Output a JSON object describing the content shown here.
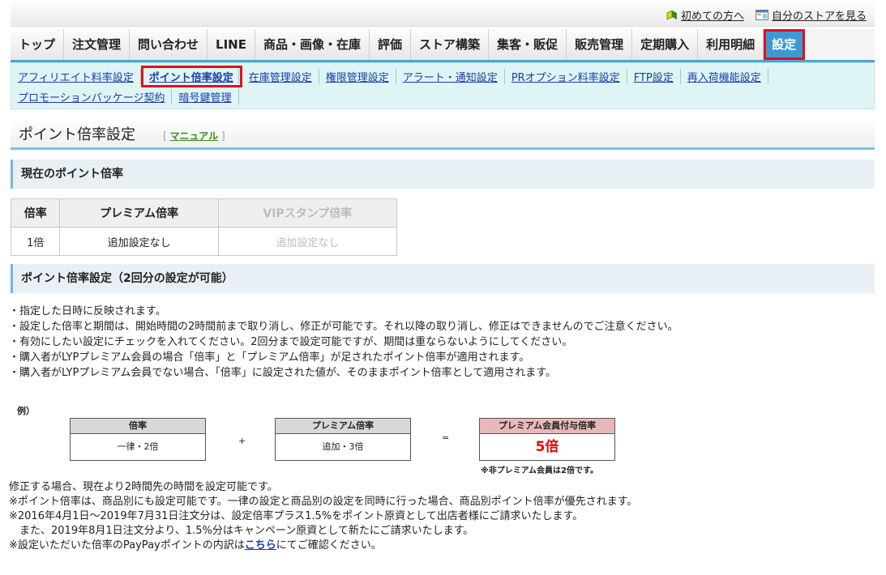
{
  "toplinks": {
    "beginner": "初めての方へ",
    "view_store": "自分のストアを見る"
  },
  "mainnav": [
    "トップ",
    "注文管理",
    "問い合わせ",
    "LINE",
    "商品・画像・在庫",
    "評価",
    "ストア構築",
    "集客・販促",
    "販売管理",
    "定期購入",
    "利用明細",
    "設定"
  ],
  "subnav": {
    "row1": [
      "アフィリエイト料率設定",
      "ポイント倍率設定",
      "在庫管理設定",
      "権限管理設定",
      "アラート・通知設定",
      "PRオプション料率設定",
      "FTP設定",
      "再入荷機能設定"
    ],
    "row2": [
      "プロモーションパッケージ契約",
      "暗号鍵管理"
    ]
  },
  "page": {
    "title": "ポイント倍率設定",
    "manual_open": "[",
    "manual": "マニュアル",
    "manual_close": "]"
  },
  "section1": "現在のポイント倍率",
  "rate_table": {
    "headers": [
      "倍率",
      "プレミアム倍率",
      "VIPスタンプ倍率"
    ],
    "values": [
      "1倍",
      "追加設定なし",
      "追加設定なし"
    ]
  },
  "section2": "ポイント倍率設定（2回分の設定が可能）",
  "notes": [
    "・指定した日時に反映されます。",
    "・設定した倍率と期間は、開始時間の2時間前まで取り消し、修正が可能です。それ以降の取り消し、修正はできませんのでご注意ください。",
    "・有効にしたい設定にチェックを入れてください。2回分まで設定可能ですが、期間は重ならないようにしてください。",
    "・購入者がLYPプレミアム会員の場合「倍率」と「プレミアム倍率」が足されたポイント倍率が適用されます。",
    "・購入者がLYPプレミアム会員でない場合、「倍率」に設定された値が、そのままポイント倍率として適用されます。"
  ],
  "example": {
    "label": "例）",
    "box1": {
      "head": "倍率",
      "body": "一律・2倍"
    },
    "plus": "+",
    "box2": {
      "head": "プレミアム倍率",
      "body": "追加・3倍"
    },
    "equals": "=",
    "box3": {
      "head": "プレミアム会員付与倍率",
      "body": "5倍"
    },
    "note": "※非プレミアム会員は2倍です。"
  },
  "bottom_notes": {
    "l1": "修正する場合、現在より2時間先の時間を設定可能です。",
    "l2": "※ポイント倍率は、商品別にも設定可能です。一律の設定と商品別の設定を同時に行った場合、商品別ポイント倍率が優先されます。",
    "l3": "※2016年4月1日～2019年7月31日注文分は、設定倍率プラス1.5%をポイント原資として出店者様にご請求いたします。",
    "l4": "　また、2019年8月1日注文分より、1.5%分はキャンペーン原資として新たにご請求いたします。",
    "l5_pre": "※設定いただいた倍率のPayPayポイントの内訳は",
    "l5_link": "こちら",
    "l5_post": "にてご確認ください。"
  }
}
